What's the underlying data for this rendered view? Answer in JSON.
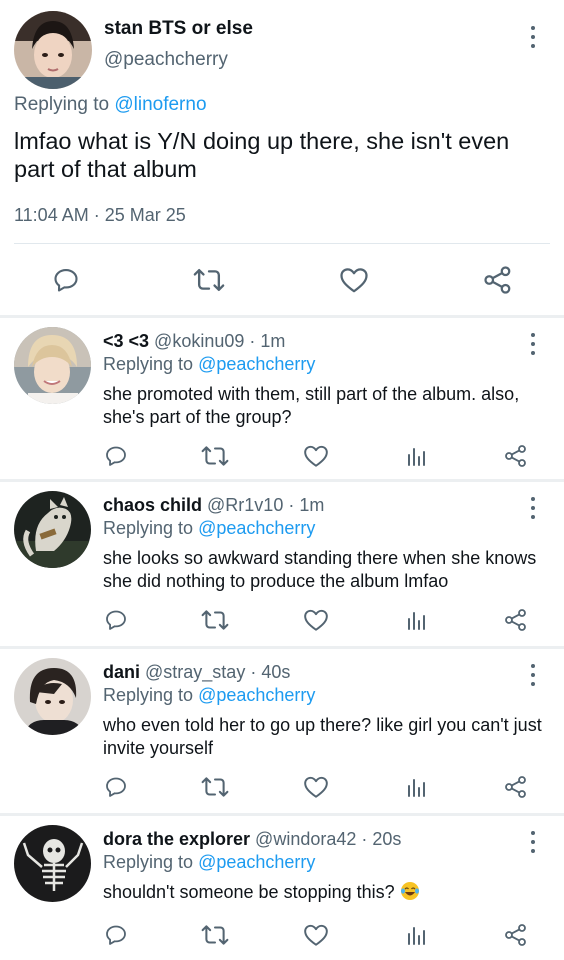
{
  "main_tweet": {
    "display_name": "stan BTS or else",
    "handle": "@peachcherry",
    "replying_prefix": "Replying to ",
    "replying_to": "@linoferno",
    "text": "lmfao what is Y/N doing up there, she isn't even part of that album",
    "timestamp": "11:04 AM · 25 Mar 25"
  },
  "replies": [
    {
      "display_name": "<3 <3",
      "meta": " @kokinu09 · 1m",
      "replying_prefix": "Replying to ",
      "replying_to": "@peachcherry",
      "text": "she promoted with them, still part of the album. also, she's part of the group?"
    },
    {
      "display_name": "chaos child",
      "meta": " @Rr1v10 · 1m",
      "replying_prefix": "Replying to ",
      "replying_to": "@peachcherry",
      "text": "she looks so awkward standing there when she knows she did nothing to produce the album lmfao"
    },
    {
      "display_name": "dani",
      "meta": " @stray_stay · 40s",
      "replying_prefix": "Replying to ",
      "replying_to": "@peachcherry",
      "text": "who even told her to go up there? like girl you can't just invite yourself"
    },
    {
      "display_name": "dora the explorer",
      "meta": " @windora42 · 20s",
      "replying_prefix": "Replying to ",
      "replying_to": "@peachcherry",
      "text": "shouldn't someone be stopping this? "
    }
  ],
  "icons": {
    "reply": "speech-bubble-icon",
    "retweet": "retweet-icon",
    "like": "heart-icon",
    "views": "bar-chart-icon",
    "share": "share-icon",
    "more": "vertical-dots-icon",
    "laugh_emoji": "tears-of-joy-emoji"
  },
  "colors": {
    "link": "#1d9bf0",
    "secondary_text": "#536471",
    "icon": "#536471",
    "separator": "#eceff1"
  }
}
